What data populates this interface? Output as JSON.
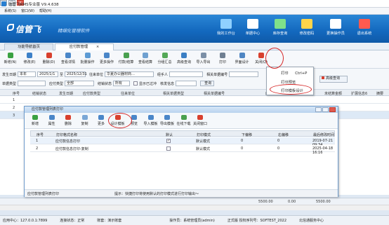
{
  "app": {
    "title": "信管飞RMS专业版 V9.4.638",
    "win_buttons": [
      "–",
      "□",
      "×"
    ]
  },
  "menu": [
    "系统(S)",
    "窗口(W)",
    "帮助(H)"
  ],
  "banner": {
    "logo": "信管飞",
    "slogan": "精细化管理软件",
    "nav": [
      {
        "label": "我的工作台",
        "color": "#8fd0ff"
      },
      {
        "label": "单据中心",
        "color": "#ffffff"
      },
      {
        "label": "库存查询",
        "color": "#7fe08a"
      },
      {
        "label": "修改密码",
        "color": "#ffd54a"
      },
      {
        "label": "更换操作员",
        "color": "#ffffff"
      },
      {
        "label": "退出系统",
        "color": "#ff5a4f"
      }
    ]
  },
  "tabs": [
    "功能导航首页",
    "应付款管理"
  ],
  "toolbar": [
    {
      "label": "新增(N)",
      "color": "#3aa142"
    },
    {
      "label": "修改(E)",
      "color": "#3c80c8"
    },
    {
      "label": "删除(D)",
      "color": "#d8402e"
    },
    {
      "label": "查看详情",
      "color": "#4a86c8"
    },
    {
      "label": "批量操作",
      "color": "#5d9bd4"
    },
    {
      "label": "更多操作",
      "color": "#4a86c8"
    },
    {
      "label": "付款/结算",
      "color": "#49a04f"
    },
    {
      "label": "查看结算",
      "color": "#6fa0d0"
    },
    {
      "label": "分组汇总",
      "color": "#54a857"
    },
    {
      "label": "高级查询",
      "color": "#3b7fc4"
    },
    {
      "label": "导入导出",
      "color": "#7b8fa6"
    },
    {
      "label": "打印",
      "color": "#6f7f92"
    },
    {
      "label": "界面设计",
      "color": "#4f86c3"
    },
    {
      "label": "关闭(Q)",
      "color": "#d8402e"
    }
  ],
  "filters": {
    "row1": {
      "date_label": "发生日期",
      "date_mode": "本年",
      "date_from": "2025/1/1",
      "to": "至",
      "date_to": "2025/12/31",
      "unit_label": "往来单位",
      "unit_value": "华夏办公器材商…",
      "handler_label": "经手人",
      "ref_label": "相关单据编号"
    },
    "row2": {
      "doc_label": "单据类型",
      "type_label": "应付类型",
      "type_value": "全部",
      "status_label": "结销状态",
      "status_value": "所有",
      "check_label": "显示已过冲",
      "detail_label": "核发信息",
      "query_btn": "查询",
      "adv_btn": "高级查询"
    }
  },
  "grid": {
    "headers": [
      "序号",
      "结销状态",
      "发生日期",
      "应付款类型",
      "往来单位",
      "相关单据类型",
      "相关单据编号",
      "应付金额",
      "已结算金额",
      "未结算金额",
      "扩展信息6",
      "摘要"
    ],
    "rows": [
      "1",
      "2",
      "3"
    ],
    "totals": [
      "5500.00",
      "0.00",
      "5500.00"
    ]
  },
  "popup": {
    "items": [
      "打印",
      "打印预览",
      "打印模板设计"
    ],
    "shortcut": "Ctrl+P"
  },
  "dialog": {
    "title": "应付款管理列表打印",
    "toolbar": [
      "新增",
      "属性",
      "删除",
      "复制",
      "更多",
      "设计模板",
      "预览",
      "导入模板",
      "导出模板",
      "在线下载",
      "关闭窗口"
    ],
    "toolbar_colors": [
      "#3aa142",
      "#4a86c8",
      "#d8402e",
      "#7aa7d6",
      "#4a86c8",
      "#d8402e",
      "#4a86c8",
      "#4a86c8",
      "#4a86c8",
      "#49a04f",
      "#d8402e"
    ],
    "headers": [
      "序号",
      "打印格式名称",
      "默认",
      "打印模式",
      "下偏移",
      "右偏移",
      "最后修改时间"
    ],
    "rows": [
      {
        "no": "1",
        "name": "应付款信息打印",
        "default": true,
        "mode": "默认模式",
        "down": "0",
        "right": "0",
        "time": "2019-07-21 09:34"
      },
      {
        "no": "2",
        "name": "应付款信息打印-复制",
        "default": false,
        "mode": "默认模式",
        "down": "0",
        "right": "0",
        "time": "2025-04-18 16:16"
      }
    ],
    "status_left": "应付款管理列表打印",
    "status_tip": "提示：快捷打印将使用默认的打印模式进行打印输出～"
  },
  "statusbar": {
    "app_center": "应用中心：127.0.0.1:7899",
    "conn": "连接状态：正常",
    "user": "账套：演示账套",
    "operator": "操作员：系统管理员(admin)",
    "license": "正式版 授权序列号：SOFTEST_2022",
    "vendor": "北信通服务中心"
  }
}
